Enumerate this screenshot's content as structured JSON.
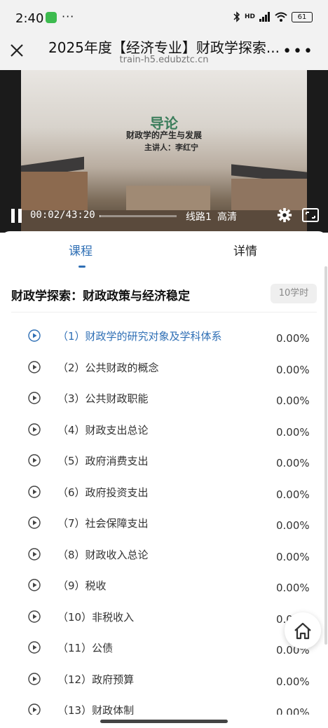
{
  "status_bar": {
    "time": "2:40",
    "dots": "···",
    "network": "HD",
    "battery": "61"
  },
  "header": {
    "title": "2025年度【经济专业】财政学探索...",
    "url": "train-h5.edubztc.cn",
    "close_icon": "close-icon",
    "more_icon": "more-icon"
  },
  "video": {
    "overlay_title": "导论",
    "overlay_subtitle": "财政学的产生与发展",
    "overlay_host": "主讲人：李红宁",
    "timecode": "00:02/43:20",
    "progress": 0.001,
    "route": "线路1",
    "quality": "高清"
  },
  "tabs": [
    {
      "label": "课程",
      "active": true
    },
    {
      "label": "详情",
      "active": false
    }
  ],
  "course": {
    "title": "财政学探索：财政政策与经济稳定",
    "hours": "10学时"
  },
  "lessons": [
    {
      "label": "（1）财政学的研究对象及学科体系",
      "progress": "0.00%",
      "active": true
    },
    {
      "label": "（2）公共财政的概念",
      "progress": "0.00%",
      "active": false
    },
    {
      "label": "（3）公共财政职能",
      "progress": "0.00%",
      "active": false
    },
    {
      "label": "（4）财政支出总论",
      "progress": "0.00%",
      "active": false
    },
    {
      "label": "（5）政府消费支出",
      "progress": "0.00%",
      "active": false
    },
    {
      "label": "（6）政府投资支出",
      "progress": "0.00%",
      "active": false
    },
    {
      "label": "（7）社会保障支出",
      "progress": "0.00%",
      "active": false
    },
    {
      "label": "（8）财政收入总论",
      "progress": "0.00%",
      "active": false
    },
    {
      "label": "（9）税收",
      "progress": "0.00%",
      "active": false
    },
    {
      "label": "（10）非税收入",
      "progress": "0.00%",
      "active": false
    },
    {
      "label": "（11）公债",
      "progress": "0.00%",
      "active": false
    },
    {
      "label": "（12）政府预算",
      "progress": "0.00%",
      "active": false
    },
    {
      "label": "（13）财政体制",
      "progress": "0.00%",
      "active": false
    }
  ],
  "colors": {
    "accent": "#2f6fb5",
    "text": "#333333",
    "badge_bg": "#efefef"
  }
}
